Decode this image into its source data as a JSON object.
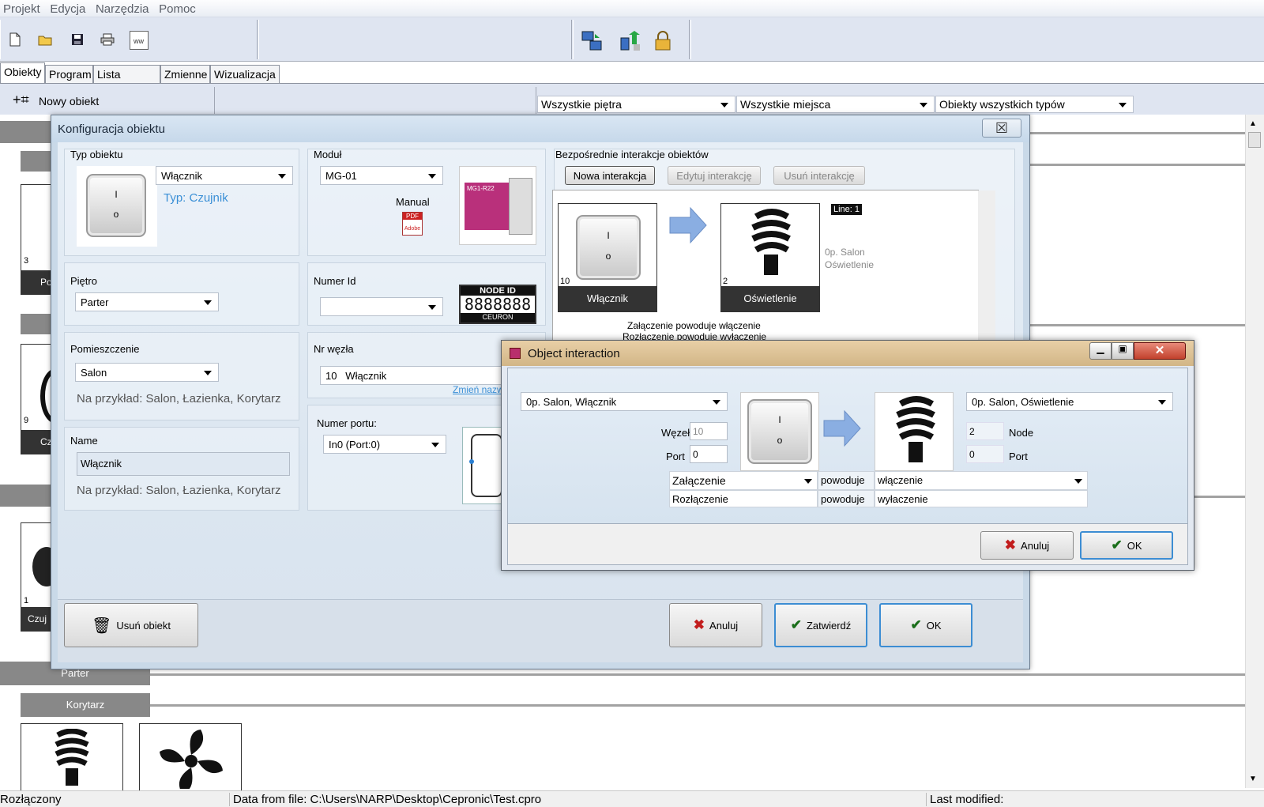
{
  "menu": [
    "Projekt",
    "Edycja",
    "Narzędzia",
    "Pomoc"
  ],
  "tabs": [
    "Obiekty",
    "Program",
    "Lista węzłów",
    "Zmienne",
    "Wizualizacja"
  ],
  "new_object_label": "Nowy obiekt",
  "filters": {
    "floors": "Wszystkie piętra",
    "places": "Wszystkie miejsca",
    "types": "Obiekty wszystkich typów"
  },
  "background": {
    "card_numbers": [
      "3",
      "9",
      "1"
    ],
    "card_labels": [
      "Po",
      "Cz",
      "Czuj"
    ],
    "group_parter": "Parter",
    "group_korytarz": "Korytarz"
  },
  "config_window": {
    "title": "Konfiguracja obiektu",
    "close_glyph": "☒",
    "type_label": "Typ obiektu",
    "type_value": "Włącznik",
    "type_sub": "Typ: Czujnik",
    "module_label": "Moduł",
    "module_value": "MG-01",
    "manual_label": "Manual",
    "pdf_text": "PDF",
    "pdf_sub": "Adobe",
    "device_text": "MG1-R22",
    "floor_label": "Piętro",
    "floor_value": "Parter",
    "numer_id_label": "Numer Id",
    "numer_id_value": "",
    "node_id_title": "NODE ID",
    "node_id_digits": "8888888",
    "node_id_brand": "CEURON",
    "room_label": "Pomieszczenie",
    "room_value": "Salon",
    "room_hint": "Na przykład: Salon, Łazienka, Korytarz",
    "node_label": "Nr węzła",
    "node_value": "10   Włącznik",
    "change_name_link": "Zmień nazw",
    "name_label": "Name",
    "name_value": "Włącznik",
    "name_hint": "Na przykład: Salon, Łazienka, Korytarz",
    "port_label": "Numer portu:",
    "port_value": "In0 (Port:0)",
    "interactions_label": "Bezpośrednie interakcje obiektów",
    "btn_new": "Nowa interakcja",
    "btn_edit": "Edytuj interakcję",
    "btn_delete": "Usuń interakcję",
    "src_num": "10",
    "src_name": "Włącznik",
    "dst_num": "2",
    "dst_name": "Oświetlenie",
    "line_badge": "Line: 1",
    "dst_loc1": "0p. Salon",
    "dst_loc2": "Oświetlenie",
    "desc1": "Załączenie powoduje włączenie",
    "desc2": "Rozłączenie powoduje wyłączenie",
    "btn_delete_object": "Usuń obiekt",
    "btn_cancel": "Anuluj",
    "btn_confirm": "Zatwierdź",
    "btn_ok": "OK"
  },
  "dialog": {
    "title": "Object interaction",
    "src_select": "0p. Salon, Włącznik",
    "node_label": "Węzeł",
    "node_value": "10",
    "port_label": "Port",
    "port_value": "0",
    "dst_select": "0p. Salon, Oświetlenie",
    "dst_node_value": "2",
    "dst_node_label": "Node",
    "dst_port_value": "0",
    "dst_port_label": "Port",
    "row1_trigger": "Załączenie",
    "row1_verb": "powoduje",
    "row1_action": "włączenie",
    "row2_trigger": "Rozłączenie",
    "row2_verb": "powoduje",
    "row2_action": "wyłaczenie",
    "btn_cancel": "Anuluj",
    "btn_ok": "OK"
  },
  "status": {
    "connection": "Rozłączony",
    "file": "Data from file: C:\\Users\\NARP\\Desktop\\Cepronic\\Test.cpro",
    "modified": "Last modified:"
  },
  "colors": {
    "link": "#3a8fd6",
    "group_label_bg": "#888888",
    "dialog_title": "#d8bd90"
  }
}
